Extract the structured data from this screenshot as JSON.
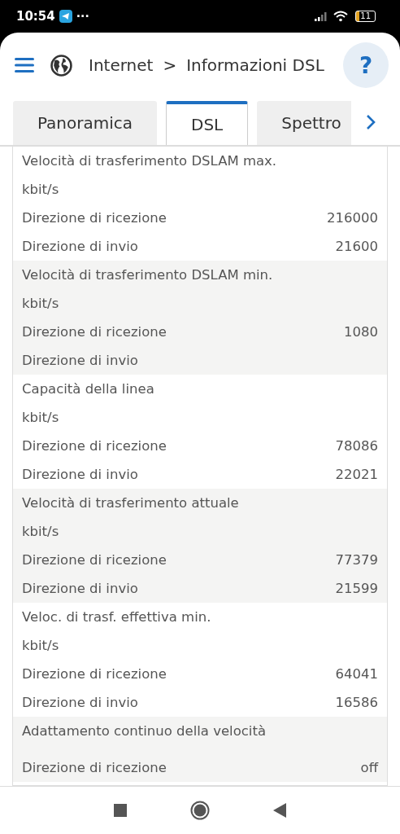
{
  "status_bar": {
    "time": "10:54",
    "more": "···",
    "battery": "11"
  },
  "header": {
    "breadcrumb": [
      "Internet",
      "Informazioni DSL"
    ],
    "separator": ">",
    "help": "?"
  },
  "tabs": [
    {
      "label": "Panoramica",
      "selected": false
    },
    {
      "label": "DSL",
      "selected": true
    },
    {
      "label": "Spettro",
      "selected": false
    }
  ],
  "groups": [
    {
      "title": "Velocità di trasferimento DSLAM max.",
      "unit": "kbit/s",
      "rows": [
        {
          "label": "Direzione di ricezione",
          "value": "216000"
        },
        {
          "label": "Direzione di invio",
          "value": "21600"
        }
      ]
    },
    {
      "title": "Velocità di trasferimento DSLAM min.",
      "unit": "kbit/s",
      "rows": [
        {
          "label": "Direzione di ricezione",
          "value": "1080"
        },
        {
          "label": "Direzione di invio"
        }
      ]
    },
    {
      "title": "Capacità della linea",
      "unit": "kbit/s",
      "rows": [
        {
          "label": "Direzione di ricezione",
          "value": "78086"
        },
        {
          "label": "Direzione di invio",
          "value": "22021"
        }
      ]
    },
    {
      "title": "Velocità di trasferimento attuale",
      "unit": "kbit/s",
      "rows": [
        {
          "label": "Direzione di ricezione",
          "value": "77379"
        },
        {
          "label": "Direzione di invio",
          "value": "21599"
        }
      ]
    },
    {
      "title": "Veloc. di trasf. effettiva min.",
      "unit": "kbit/s",
      "rows": [
        {
          "label": "Direzione di ricezione",
          "value": "64041"
        },
        {
          "label": "Direzione di invio",
          "value": "16586"
        }
      ]
    },
    {
      "title": "Adattamento continuo della velocità",
      "rows": [
        {
          "label": "Direzione di ricezione",
          "value": "off"
        }
      ]
    }
  ]
}
